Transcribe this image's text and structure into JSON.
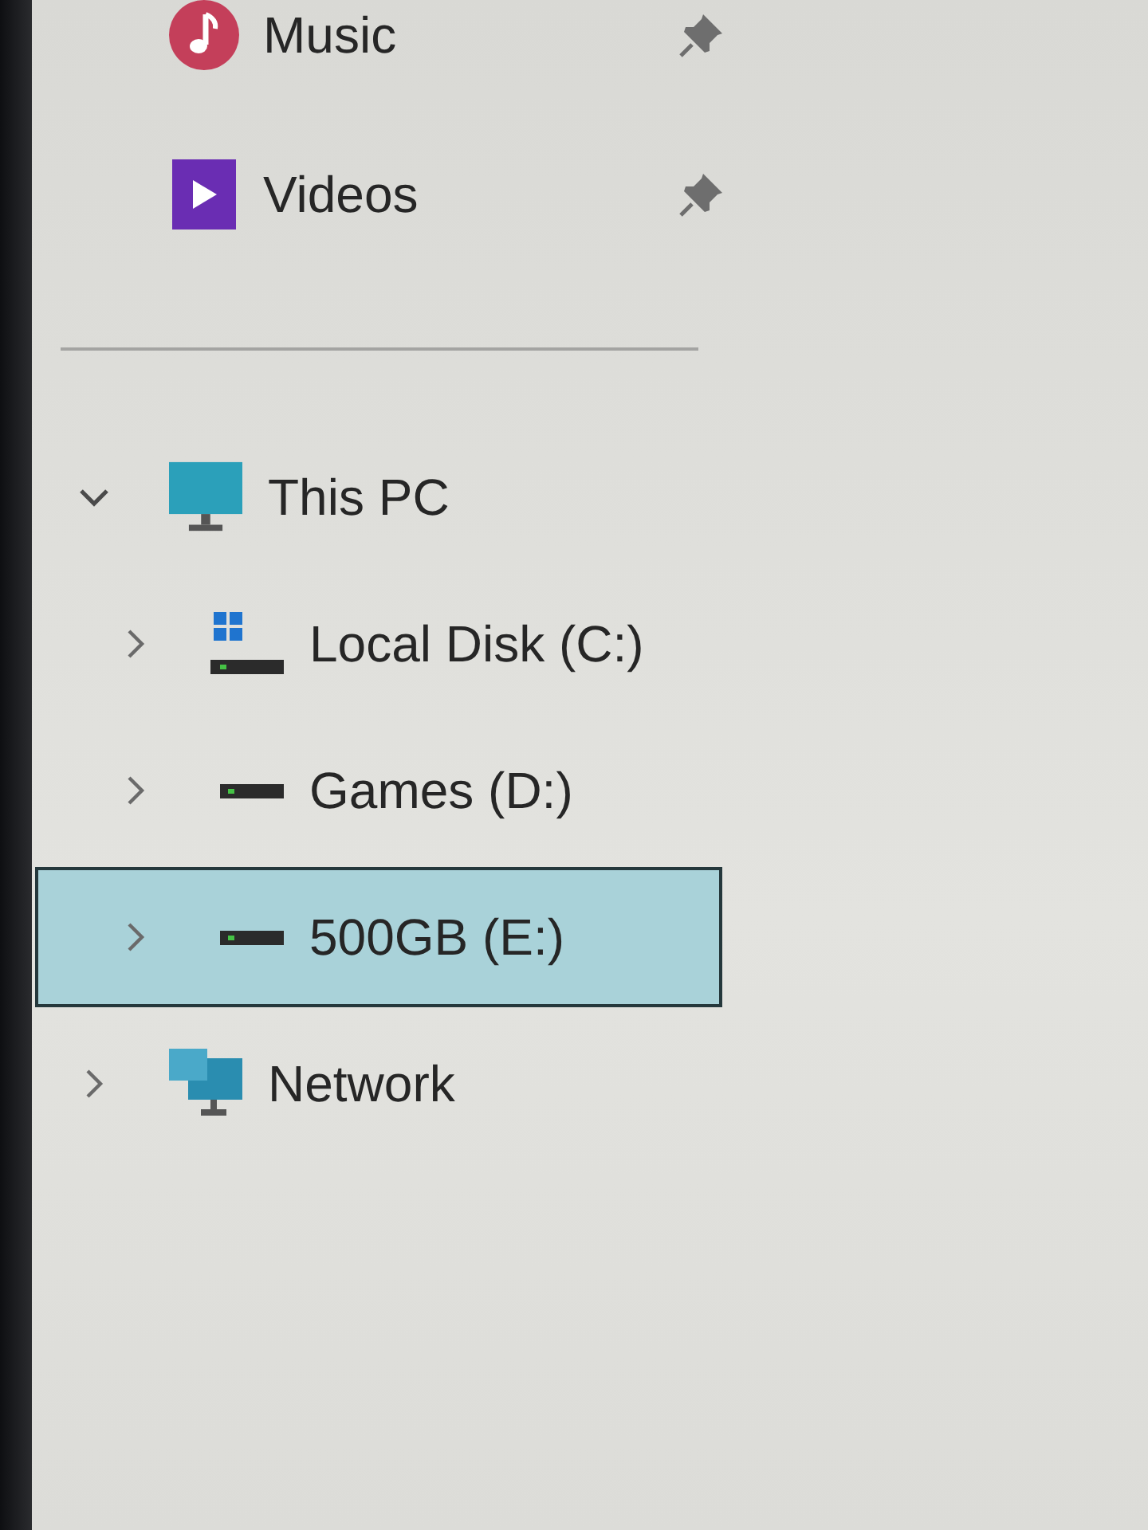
{
  "quick_access": [
    {
      "label": "Music",
      "kind": "music",
      "pinned": true
    },
    {
      "label": "Videos",
      "kind": "videos",
      "pinned": true
    }
  ],
  "tree": [
    {
      "label": "This PC",
      "kind": "pc",
      "expanded": true,
      "selected": false,
      "children": [
        {
          "label": "Local Disk (C:)",
          "kind": "system-drive",
          "expanded": false,
          "selected": false
        },
        {
          "label": "Games (D:)",
          "kind": "drive",
          "expanded": false,
          "selected": false
        },
        {
          "label": "500GB (E:)",
          "kind": "drive",
          "expanded": false,
          "selected": true
        }
      ]
    },
    {
      "label": "Network",
      "kind": "network",
      "expanded": false,
      "selected": false
    }
  ]
}
